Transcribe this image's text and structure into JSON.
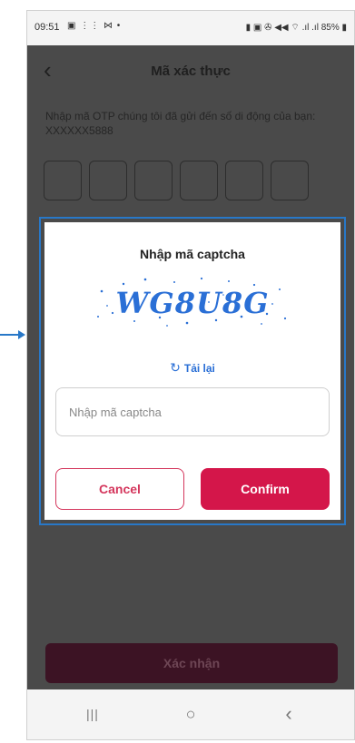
{
  "status_bar": {
    "time": "09:51",
    "left_icons": "▣ ⋮⋮ ⋈ •",
    "right_icons": "▮ ▣ ✇ ◀◀ ⌔ .ıl .ıl 85% ▮"
  },
  "app_bar": {
    "back_icon": "‹",
    "title": "Mã xác thực"
  },
  "description": "Nhập mã OTP chúng tôi đã gửi đến số di động của bạn: XXXXXX5888",
  "otp_box_count": 6,
  "dialog": {
    "title": "Nhập mã captcha",
    "captcha_text": "WG8U8G",
    "reload_icon": "↻",
    "reload_label": "Tải lại",
    "input_placeholder": "Nhập mã captcha",
    "input_value": "",
    "cancel_label": "Cancel",
    "confirm_label": "Confirm"
  },
  "primary_button_label": "Xác nhận",
  "nav_bar": {
    "recent_icon": "|||",
    "home_icon": "○",
    "back_icon": "‹"
  },
  "colors": {
    "accent": "#d4164a",
    "link": "#2a6fd6",
    "captcha": "#2a6fd6",
    "highlight_frame": "#2878c8",
    "annotation_arrow": "#2878c8"
  }
}
